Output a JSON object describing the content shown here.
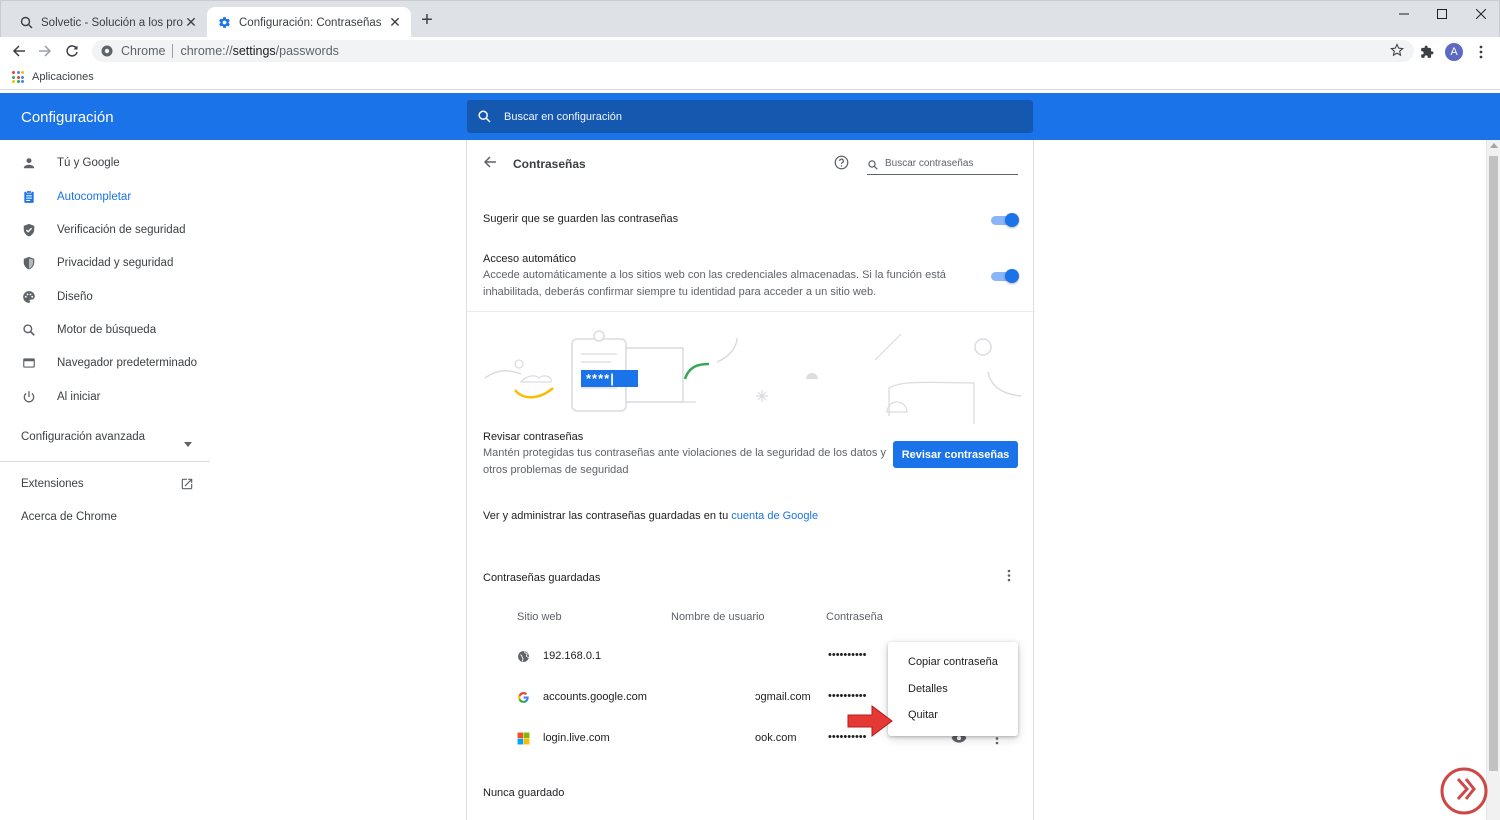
{
  "browser": {
    "tabs": [
      {
        "title": "Solvetic - Solución a los problem",
        "active": false
      },
      {
        "title": "Configuración: Contraseñas",
        "active": true
      }
    ],
    "omnibox": {
      "chip": "Chrome",
      "url_scheme": "chrome://",
      "url_host": "settings",
      "url_path": "/passwords"
    },
    "avatar_letter": "A",
    "bookmarks": {
      "apps_label": "Aplicaciones"
    }
  },
  "settings": {
    "title": "Configuración",
    "search_placeholder": "Buscar en configuración"
  },
  "sidebar": {
    "items": [
      {
        "label": "Tú y Google",
        "icon": "person-icon"
      },
      {
        "label": "Autocompletar",
        "icon": "assignment-icon",
        "active": true
      },
      {
        "label": "Verificación de seguridad",
        "icon": "shield-check-icon"
      },
      {
        "label": "Privacidad y seguridad",
        "icon": "shield-icon"
      },
      {
        "label": "Diseño",
        "icon": "palette-icon"
      },
      {
        "label": "Motor de búsqueda",
        "icon": "search-icon"
      },
      {
        "label": "Navegador predeterminado",
        "icon": "browser-icon"
      },
      {
        "label": "Al iniciar",
        "icon": "power-icon"
      }
    ],
    "advanced": "Configuración avanzada",
    "extensions": "Extensiones",
    "about": "Acerca de Chrome"
  },
  "passwords": {
    "title": "Contraseñas",
    "search_placeholder": "Buscar contraseñas",
    "offer_save": {
      "label": "Sugerir que se guarden las contraseñas",
      "enabled": true
    },
    "auto_signin": {
      "label": "Acceso automático",
      "description": "Accede automáticamente a los sitios web con las credenciales almacenadas. Si la función está inhabilitada, deberás confirmar siempre tu identidad para acceder a un sitio web.",
      "enabled": true
    },
    "check": {
      "title": "Revisar contraseñas",
      "description": "Mantén protegidas tus contraseñas ante violaciones de la seguridad de los datos y otros problemas de seguridad",
      "button": "Revisar contraseñas",
      "illustration_text": "****|"
    },
    "account_line": {
      "prefix": "Ver y administrar las contraseñas guardadas en tu ",
      "link": "cuenta de Google"
    },
    "saved_title": "Contraseñas guardadas",
    "columns": {
      "site": "Sitio web",
      "user": "Nombre de usuario",
      "password": "Contraseña"
    },
    "rows": [
      {
        "site": "192.168.0.1",
        "user": "",
        "password": "••••••••••",
        "icon": "globe-icon"
      },
      {
        "site": "accounts.google.com",
        "user": "ↄgmail.com",
        "password": "••••••••••",
        "icon": "google-icon"
      },
      {
        "site": "login.live.com",
        "user": "ook.com",
        "password": "••••••••••",
        "icon": "microsoft-icon"
      }
    ],
    "never_saved_title": "Nunca guardado"
  },
  "context_menu": {
    "items": [
      "Copiar contraseña",
      "Detalles",
      "Quitar"
    ]
  },
  "colors": {
    "accent": "#1a73e8",
    "header_search_bg": "#1558b0",
    "arrow_red": "#e53935"
  }
}
